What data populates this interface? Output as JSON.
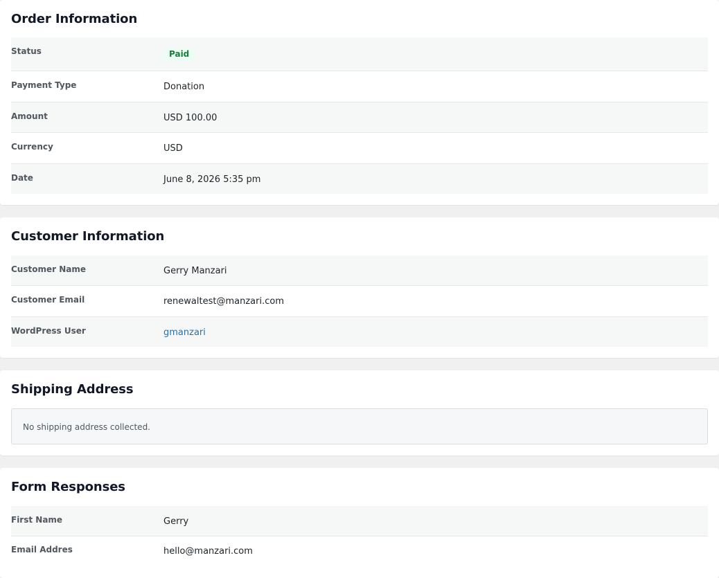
{
  "order_information": {
    "title": "Order Information",
    "rows": [
      {
        "label": "Status",
        "value": "Paid"
      },
      {
        "label": "Payment Type",
        "value": "Donation"
      },
      {
        "label": "Amount",
        "value": "USD 100.00"
      },
      {
        "label": "Currency",
        "value": "USD"
      },
      {
        "label": "Date",
        "value": "June 8, 2026 5:35 pm"
      }
    ]
  },
  "customer_information": {
    "title": "Customer Information",
    "rows": [
      {
        "label": "Customer Name",
        "value": "Gerry Manzari"
      },
      {
        "label": "Customer Email",
        "value": "renewaltest@manzari.com"
      },
      {
        "label": "WordPress User",
        "value": "gmanzari"
      }
    ]
  },
  "shipping_address": {
    "title": "Shipping Address",
    "notice": "No shipping address collected."
  },
  "form_responses": {
    "title": "Form Responses",
    "rows": [
      {
        "label": "First Name",
        "value": "Gerry"
      },
      {
        "label": "Email Addres",
        "value": "hello@manzari.com"
      }
    ]
  },
  "colors": {
    "status_paid_text": "#15803d",
    "status_paid_bg": "#ecfdf3",
    "link": "#2271b1"
  }
}
